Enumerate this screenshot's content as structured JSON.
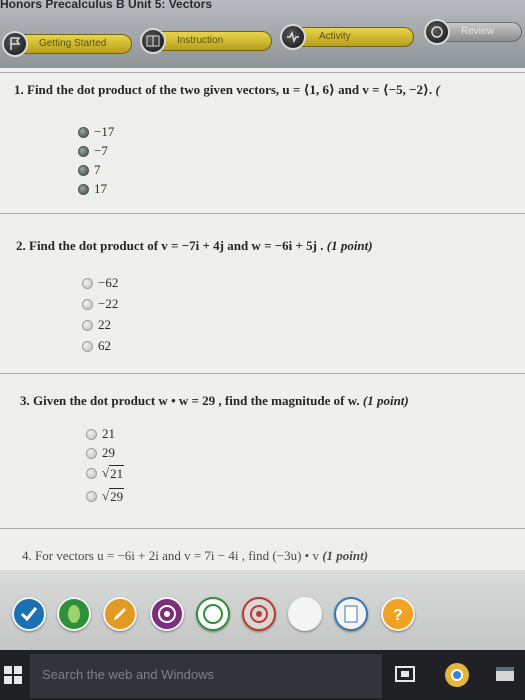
{
  "header": {
    "course_title": "Honors Precalculus B  Unit 5: Vectors",
    "tabs": {
      "getting_started": "Getting Started",
      "instruction": "Instruction",
      "activity": "Activity",
      "review": "Review"
    }
  },
  "questions": [
    {
      "number": "1.",
      "text": "Find the dot product of the two given vectors, u = ⟨1, 6⟩ and v = ⟨−5, −2⟩.",
      "points": "(",
      "options": [
        "−17",
        "−7",
        "7",
        "17"
      ]
    },
    {
      "number": "2.",
      "text": "Find the dot product of  v = −7i + 4j  and  w = −6i + 5j .",
      "points": "(1 point)",
      "options": [
        "−62",
        "−22",
        "22",
        "62"
      ]
    },
    {
      "number": "3.",
      "text": "Given the dot product  w • w = 29 , find the magnitude of w.",
      "points": "(1 point)",
      "options": [
        "21",
        "29",
        "21",
        "29"
      ]
    },
    {
      "number": "4.",
      "text": "For vectors  u = −6i + 2i  and  v = 7i − 4i , find (−3u) • v",
      "points": "(1 point)"
    }
  ],
  "taskbar": {
    "search_placeholder": "Search the web and Windows"
  },
  "dock_icons": [
    "check-icon",
    "leaf-icon",
    "pencil-icon",
    "target-icon",
    "circle-icon",
    "target-icon",
    "blank-icon",
    "document-icon",
    "help-icon"
  ],
  "colors": {
    "tab_active": "#d8c636",
    "dock_green": "#2f8f3a",
    "dock_orange": "#e39a22",
    "dock_purple": "#7a2f7c",
    "taskbar": "#1f2125"
  }
}
